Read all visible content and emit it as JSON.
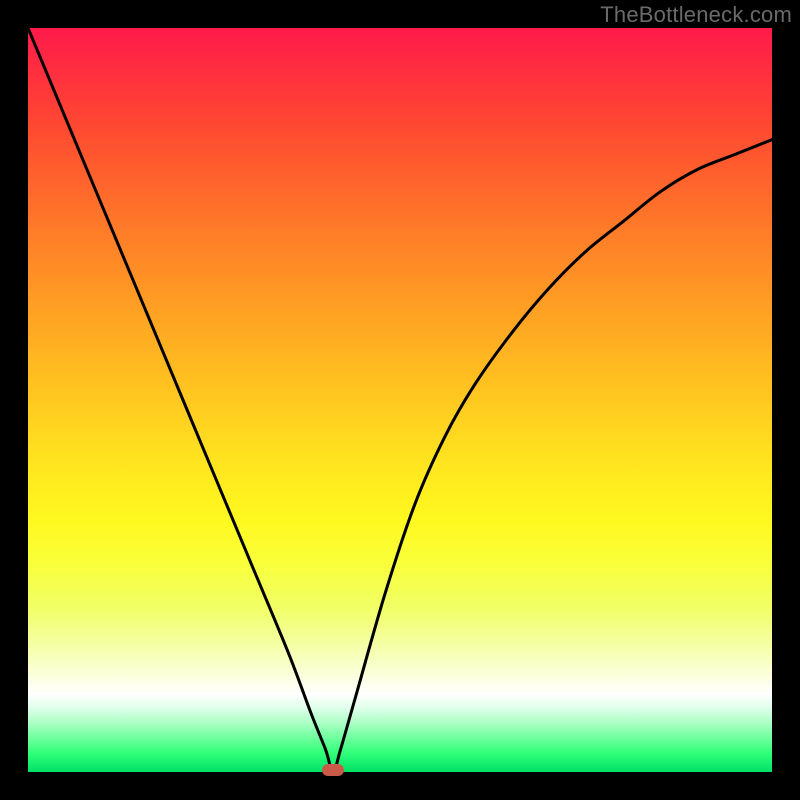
{
  "watermark": "TheBottleneck.com",
  "colors": {
    "frame": "#000000",
    "curve": "#000000",
    "marker": "#c95a4a"
  },
  "chart_data": {
    "type": "line",
    "title": "",
    "xlabel": "",
    "ylabel": "",
    "xlim": [
      0,
      100
    ],
    "ylim": [
      0,
      100
    ],
    "grid": false,
    "legend": false,
    "marker": {
      "x": 41,
      "y": 0
    },
    "series": [
      {
        "name": "bottleneck-curve",
        "x": [
          0,
          5,
          10,
          15,
          20,
          25,
          30,
          35,
          38,
          40,
          41,
          42,
          44,
          48,
          52,
          56,
          60,
          65,
          70,
          75,
          80,
          85,
          90,
          95,
          100
        ],
        "y": [
          100,
          88,
          76,
          64,
          52,
          40,
          28,
          16,
          8,
          3,
          0,
          3,
          10,
          24,
          36,
          45,
          52,
          59,
          65,
          70,
          74,
          78,
          81,
          83,
          85
        ]
      }
    ]
  }
}
